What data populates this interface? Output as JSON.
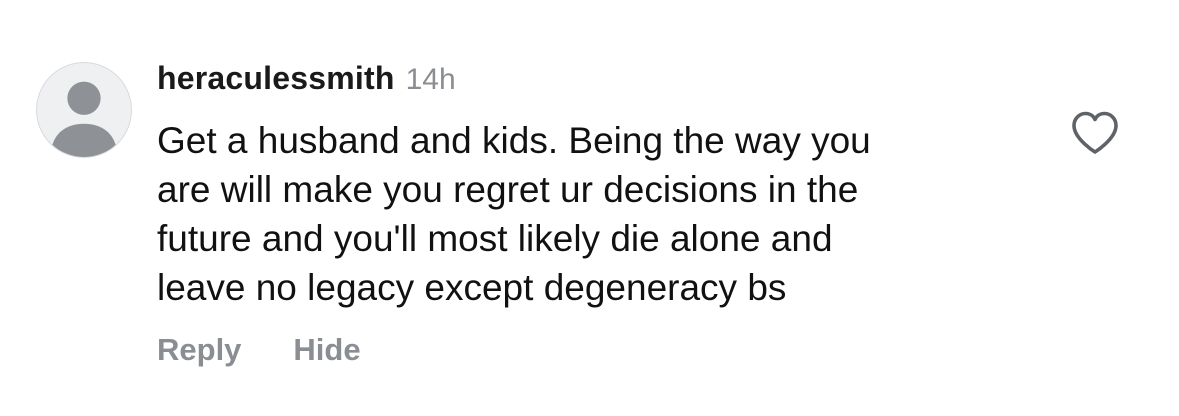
{
  "comment": {
    "username": "heraculessmith",
    "timestamp": "14h",
    "text_lines": [
      "Get a husband and kids. Being the way you",
      "are will make you regret ur decisions in the",
      "future and you'll most likely die alone and",
      "leave no legacy except degeneracy bs"
    ],
    "actions": {
      "reply": "Reply",
      "hide": "Hide"
    },
    "icons": {
      "avatar": "default-user-avatar-icon",
      "like": "heart-outline-icon"
    }
  },
  "colors": {
    "secondary_text": "#8a8d91",
    "avatar_bg": "#eef0f2",
    "avatar_figure": "#8e9196"
  }
}
